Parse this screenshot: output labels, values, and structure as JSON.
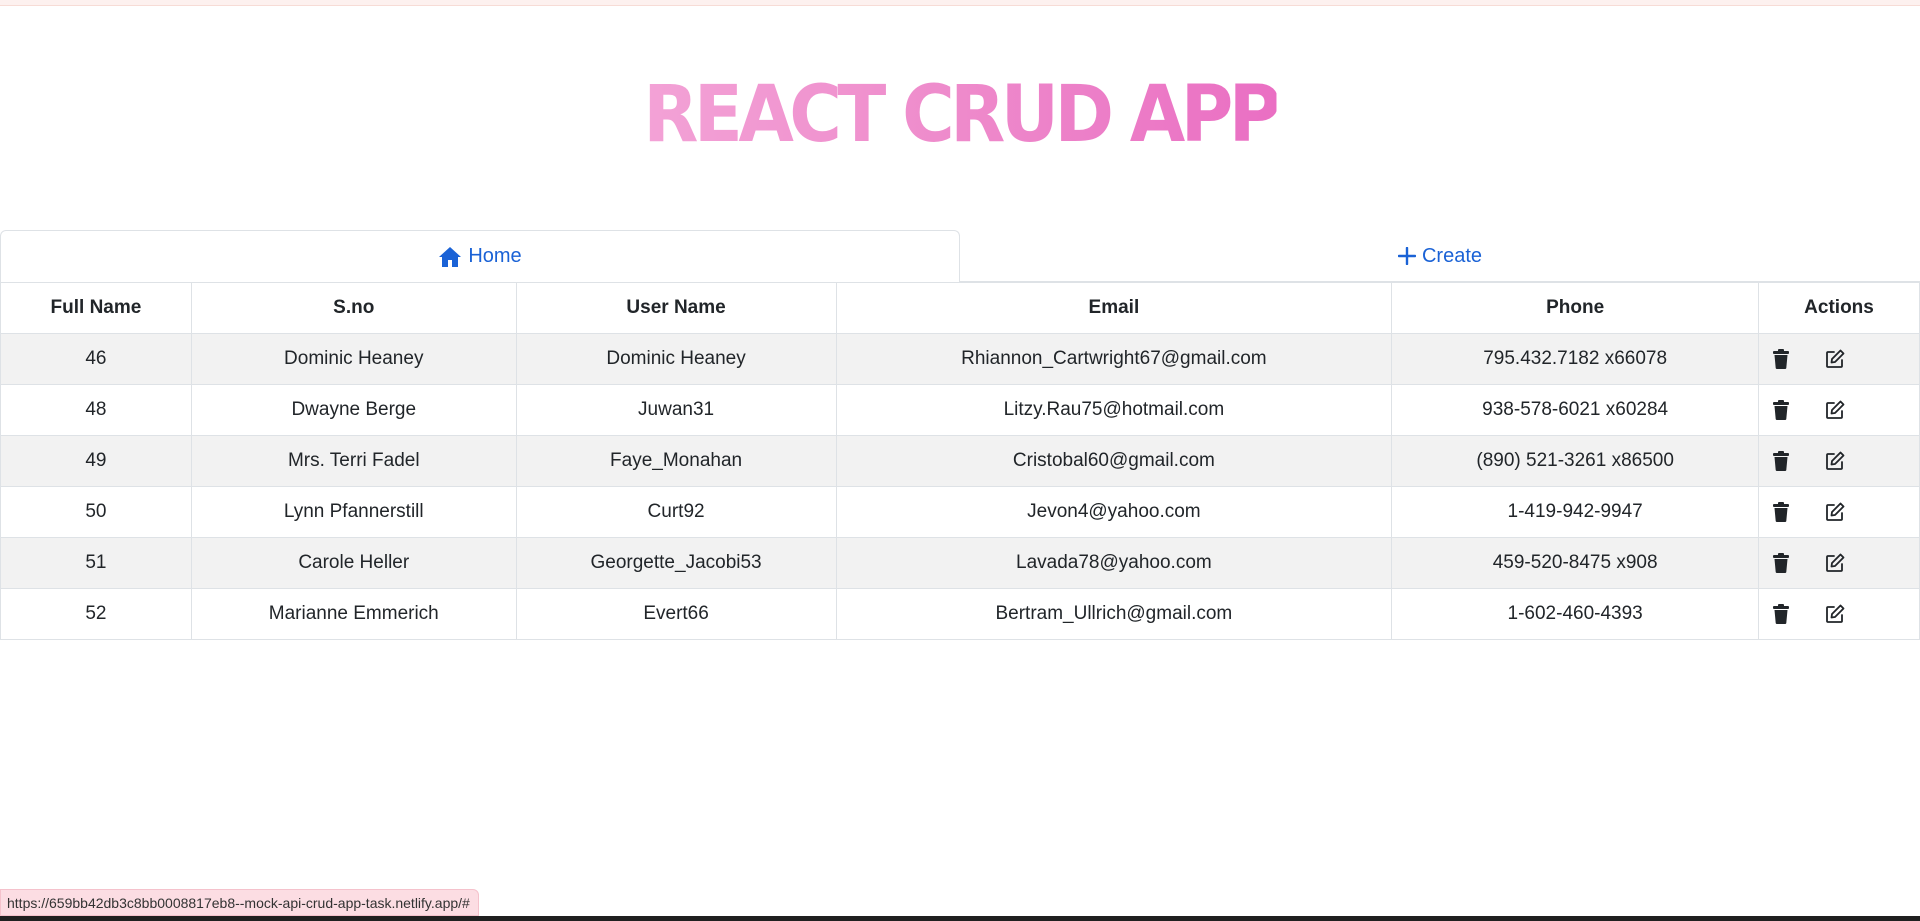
{
  "app": {
    "title": "REACT CRUD APP"
  },
  "nav": {
    "home_label": "Home",
    "create_label": "Create"
  },
  "table": {
    "headers": [
      "Full Name",
      "S.no",
      "User Name",
      "Email",
      "Phone",
      "Actions"
    ],
    "rows": [
      [
        "46",
        "Dominic Heaney",
        "Dominic Heaney",
        "Rhiannon_Cartwright67@gmail.com",
        "795.432.7182 x66078"
      ],
      [
        "48",
        "Dwayne Berge",
        "Juwan31",
        "Litzy.Rau75@hotmail.com",
        "938-578-6021 x60284"
      ],
      [
        "49",
        "Mrs. Terri Fadel",
        "Faye_Monahan",
        "Cristobal60@gmail.com",
        "(890) 521-3261 x86500"
      ],
      [
        "50",
        "Lynn Pfannerstill",
        "Curt92",
        "Jevon4@yahoo.com",
        "1-419-942-9947"
      ],
      [
        "51",
        "Carole Heller",
        "Georgette_Jacobi53",
        "Lavada78@yahoo.com",
        "459-520-8475 x908"
      ],
      [
        "52",
        "Marianne Emmerich",
        "Evert66",
        "Bertram_Ullrich@gmail.com",
        "1-602-460-4393"
      ]
    ],
    "row_actions": [
      "trash-icon",
      "edit-icon"
    ]
  },
  "status_bar": {
    "url": "https://659bb42db3c8bb0008817eb8--mock-api-crud-app-task.netlify.app/#"
  },
  "colors": {
    "link": "#1a62d6",
    "title_gradient_start": "#f3a2d6",
    "title_gradient_end": "#ea6fc3",
    "striped_row": "#f2f2f2",
    "status_bg": "#fcdde3"
  }
}
